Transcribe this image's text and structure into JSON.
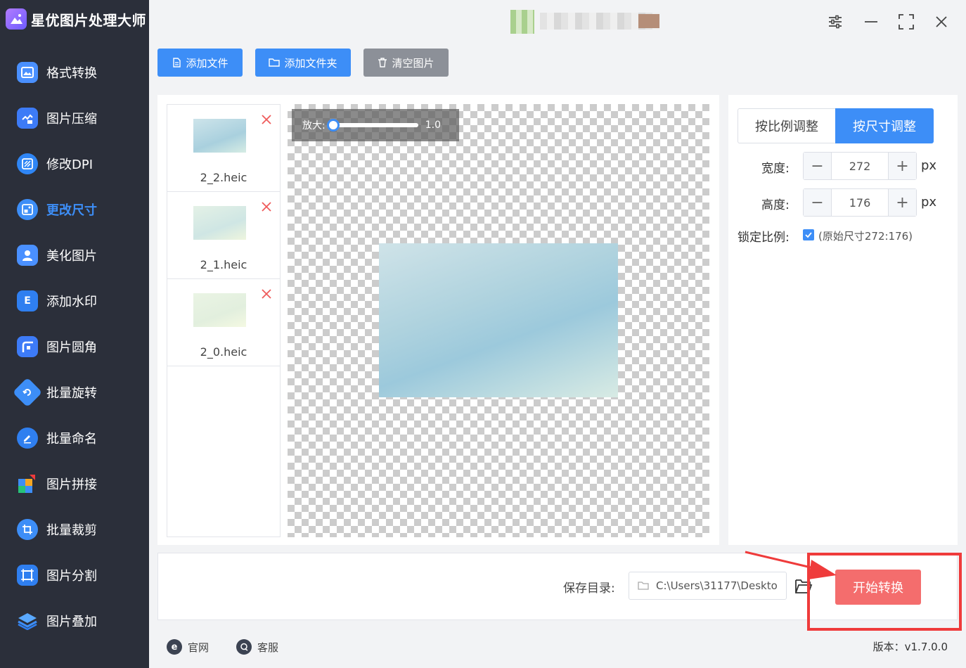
{
  "app": {
    "title": "星优图片处理大师"
  },
  "sidebar": {
    "items": [
      {
        "label": "格式转换",
        "icon": "format-convert-icon",
        "color": "#4a90ff"
      },
      {
        "label": "图片压缩",
        "icon": "compress-icon",
        "color": "#3d7bf7"
      },
      {
        "label": "修改DPI",
        "icon": "dpi-icon",
        "color": "#2f86f5"
      },
      {
        "label": "更改尺寸",
        "icon": "resize-icon",
        "color": "#3d8ef7",
        "active": true
      },
      {
        "label": "美化图片",
        "icon": "beautify-icon",
        "color": "#4a90ff"
      },
      {
        "label": "添加水印",
        "icon": "watermark-icon",
        "color": "#2f7ff0"
      },
      {
        "label": "图片圆角",
        "icon": "round-corner-icon",
        "color": "#3d7bf7"
      },
      {
        "label": "批量旋转",
        "icon": "rotate-icon",
        "color": "#3d8ef7"
      },
      {
        "label": "批量命名",
        "icon": "rename-icon",
        "color": "#2f7ff0"
      },
      {
        "label": "图片拼接",
        "icon": "puzzle-icon",
        "color": "#f5a623"
      },
      {
        "label": "批量裁剪",
        "icon": "crop-icon",
        "color": "#3d8ef7"
      },
      {
        "label": "图片分割",
        "icon": "split-icon",
        "color": "#2f7ff0"
      },
      {
        "label": "图片叠加",
        "icon": "layers-icon",
        "color": "#3d8ef7"
      }
    ]
  },
  "toolbar": {
    "add_file": "添加文件",
    "add_folder": "添加文件夹",
    "clear_images": "清空图片"
  },
  "files": [
    {
      "name": "2_2.heic"
    },
    {
      "name": "2_1.heic"
    },
    {
      "name": "2_0.heic"
    }
  ],
  "preview": {
    "zoom_label": "放大:",
    "zoom_value": "1.0",
    "zoom_fraction": 0.0
  },
  "settings": {
    "tab_ratio": "按比例调整",
    "tab_size": "按尺寸调整",
    "width_label": "宽度:",
    "width_value": "272",
    "height_label": "高度:",
    "height_value": "176",
    "unit": "px",
    "lock_label": "锁定比例:",
    "lock_note": "(原始尺寸272:176)",
    "lock_checked": true
  },
  "bottom": {
    "save_label": "保存目录:",
    "save_path": "C:\\Users\\31177\\Deskto",
    "start_button": "开始转换"
  },
  "footer": {
    "website": "官网",
    "support": "客服",
    "version": "版本：v1.7.0.0"
  },
  "colors": {
    "accent": "#3d8ef7",
    "start": "#f46d6d",
    "highlight": "#ef3b3b",
    "sidebar_bg": "#2b2f3a"
  }
}
